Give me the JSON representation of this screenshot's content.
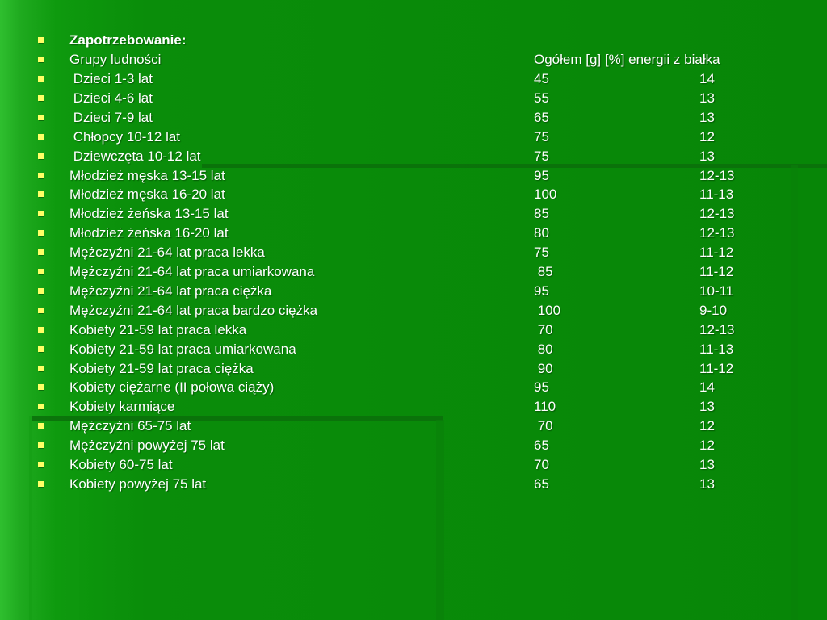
{
  "slide": {
    "title": "Zapotrzebowanie:",
    "header": {
      "group": "Grupy ludności",
      "values": "Ogółem [g] [%] energii z białka"
    },
    "rows": [
      {
        "group": " Dzieci 1-3 lat",
        "grams": "45",
        "percent": "14"
      },
      {
        "group": " Dzieci 4-6 lat",
        "grams": "55",
        "percent": "13"
      },
      {
        "group": " Dzieci 7-9 lat",
        "grams": "65",
        "percent": "13"
      },
      {
        "group": " Chłopcy 10-12 lat",
        "grams": "75",
        "percent": "12"
      },
      {
        "group": " Dziewczęta 10-12 lat",
        "grams": "75",
        "percent": "13"
      },
      {
        "group": "Młodzież męska 13-15 lat",
        "grams": "95",
        "percent": "12-13"
      },
      {
        "group": "Młodzież męska 16-20 lat",
        "grams": "100",
        "percent": "11-13"
      },
      {
        "group": "Młodzież żeńska 13-15 lat",
        "grams": "85",
        "percent": "12-13"
      },
      {
        "group": "Młodzież żeńska 16-20 lat",
        "grams": "80",
        "percent": "12-13"
      },
      {
        "group": "Mężczyźni 21-64 lat praca lekka",
        "grams": "75",
        "percent": "11-12"
      },
      {
        "group": "Mężczyźni 21-64 lat praca umiarkowana",
        "grams": " 85",
        "percent": "11-12"
      },
      {
        "group": "Mężczyźni 21-64 lat praca ciężka",
        "grams": "95",
        "percent": "10-11"
      },
      {
        "group": "Mężczyźni 21-64 lat praca bardzo ciężka",
        "grams": " 100",
        "percent": "9-10"
      },
      {
        "group": "Kobiety 21-59 lat praca lekka",
        "grams": " 70",
        "percent": "12-13"
      },
      {
        "group": "Kobiety 21-59 lat praca umiarkowana",
        "grams": " 80",
        "percent": "11-13"
      },
      {
        "group": "Kobiety 21-59 lat praca ciężka",
        "grams": " 90",
        "percent": "11-12"
      },
      {
        "group": "Kobiety ciężarne (II połowa ciąży)",
        "grams": "95",
        "percent": "14"
      },
      {
        "group": "Kobiety karmiące",
        "grams": "110",
        "percent": "13"
      },
      {
        "group": "Mężczyźni 65-75 lat",
        "grams": " 70",
        "percent": "12"
      },
      {
        "group": "Mężczyźni powyżej 75 lat",
        "grams": "65",
        "percent": "12"
      },
      {
        "group": "Kobiety 60-75 lat",
        "grams": "70",
        "percent": "13"
      },
      {
        "group": "Kobiety powyżej 75 lat",
        "grams": "65",
        "percent": "13"
      }
    ]
  },
  "colors": {
    "background": "#0a8a0a",
    "text": "#ffffff",
    "bullet": "#ffff66"
  }
}
